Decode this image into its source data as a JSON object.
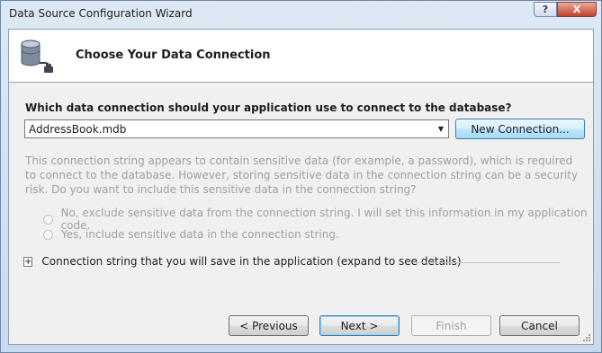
{
  "window": {
    "title": "Data Source Configuration Wizard",
    "help_label": "?",
    "close_label": "X"
  },
  "header": {
    "title": "Choose Your Data Connection",
    "icon": "database-plug-icon"
  },
  "connection": {
    "question": "Which data connection should your application use to connect to the database?",
    "selected": "AddressBook.mdb",
    "new_connection_label": "New Connection..."
  },
  "sensitive": {
    "description": "This connection string appears to contain sensitive data (for example, a password), which is required to connect to the database. However, storing sensitive data in the connection string can be a security risk. Do you want to include this sensitive data in the connection string?",
    "option_no": "No, exclude sensitive data from the connection string. I will set this information in my application code.",
    "option_yes": "Yes, include sensitive data in the connection string."
  },
  "expander": {
    "toggle": "+",
    "label": "Connection string that you will save in the application (expand to see details)"
  },
  "footer": {
    "previous_label": "< Previous",
    "next_label": "Next >",
    "finish_label": "Finish",
    "cancel_label": "Cancel"
  }
}
